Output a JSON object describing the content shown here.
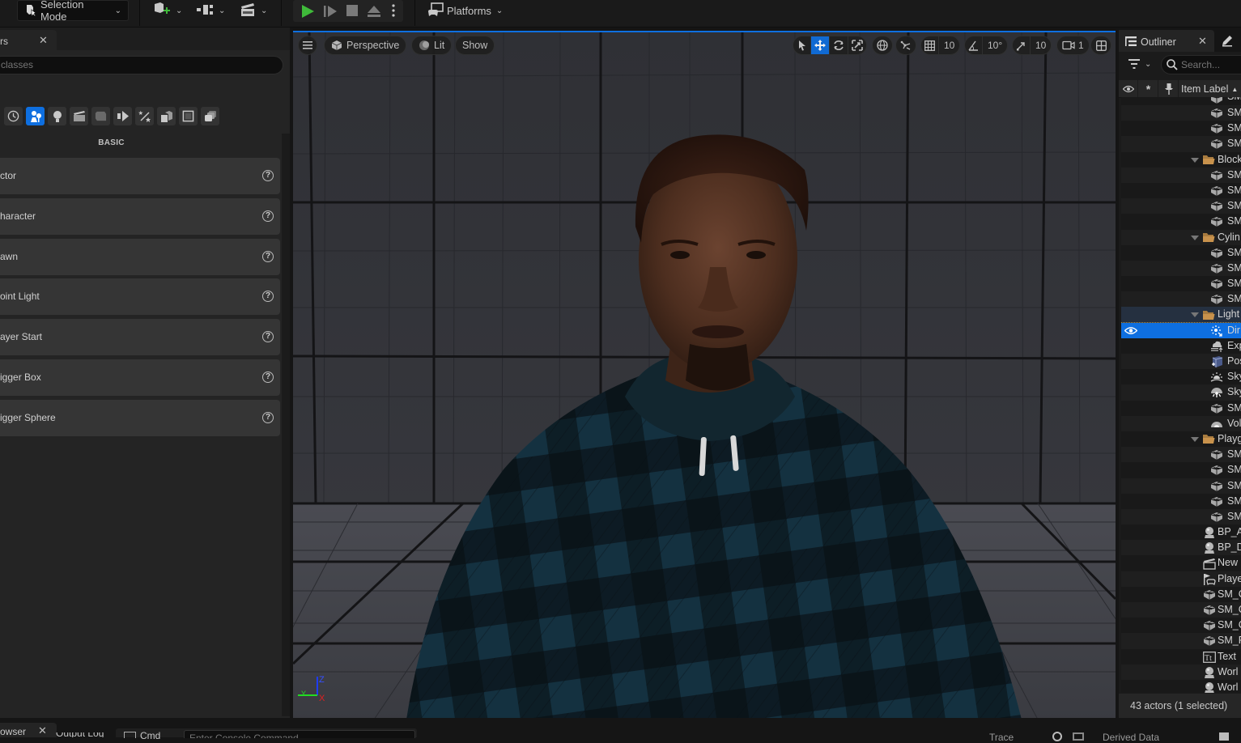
{
  "toolbar": {
    "selection_mode": "Selection Mode",
    "platforms": "Platforms",
    "accent": "#0e6fe0",
    "play_color": "#3fba3a"
  },
  "place_actors": {
    "tab_label": "rs",
    "search_placeholder": "classes",
    "category_label": "BASIC",
    "categories": [
      "recent-icon",
      "basic-icon",
      "lights-icon",
      "cinematic-icon",
      "visual-effects-icon",
      "geometry-icon",
      "volumes-icon",
      "all-classes-icon",
      "shapes-icon",
      "layers-icon"
    ],
    "active_category": 1,
    "items": [
      {
        "label": "ctor"
      },
      {
        "label": "haracter"
      },
      {
        "label": "awn"
      },
      {
        "label": "oint Light"
      },
      {
        "label": "ayer Start"
      },
      {
        "label": "igger Box"
      },
      {
        "label": "igger Sphere"
      }
    ]
  },
  "viewport": {
    "view_mode": "Perspective",
    "lighting": "Lit",
    "show": "Show",
    "grid_snap": "10",
    "rotation_snap": "10°",
    "scale_snap": "10",
    "camera_speed": "1",
    "axis_labels": {
      "x": "X",
      "y": "Y",
      "z": "Z"
    }
  },
  "outliner": {
    "tab_label": "Outliner",
    "search_placeholder": "Search...",
    "column_label": "Item Label",
    "footer": "43 actors (1 selected)",
    "rows": [
      {
        "label": "SM",
        "icon": "static-mesh-icon",
        "indent": 2,
        "partial": true
      },
      {
        "label": "SM",
        "icon": "static-mesh-icon",
        "indent": 2
      },
      {
        "label": "SM",
        "icon": "static-mesh-icon",
        "indent": 2
      },
      {
        "label": "SM",
        "icon": "static-mesh-icon",
        "indent": 2
      },
      {
        "label": "Block",
        "icon": "folder-icon",
        "indent": 1,
        "folder": true
      },
      {
        "label": "SM",
        "icon": "static-mesh-icon",
        "indent": 2
      },
      {
        "label": "SM",
        "icon": "static-mesh-icon",
        "indent": 2
      },
      {
        "label": "SM",
        "icon": "static-mesh-icon",
        "indent": 2
      },
      {
        "label": "SM",
        "icon": "static-mesh-icon",
        "indent": 2
      },
      {
        "label": "Cylin",
        "icon": "folder-icon",
        "indent": 1,
        "folder": true
      },
      {
        "label": "SM",
        "icon": "static-mesh-icon",
        "indent": 2
      },
      {
        "label": "SM",
        "icon": "static-mesh-icon",
        "indent": 2
      },
      {
        "label": "SM",
        "icon": "static-mesh-icon",
        "indent": 2
      },
      {
        "label": "SM",
        "icon": "static-mesh-icon",
        "indent": 2
      },
      {
        "label": "Light",
        "icon": "folder-icon",
        "indent": 1,
        "folder": true,
        "highlight": true
      },
      {
        "label": "Dir",
        "icon": "directional-light-icon",
        "indent": 2,
        "selected": true
      },
      {
        "label": "Exp",
        "icon": "exponential-fog-icon",
        "indent": 2
      },
      {
        "label": "Pos",
        "icon": "post-process-icon",
        "indent": 2
      },
      {
        "label": "Sky",
        "icon": "sky-atmosphere-icon",
        "indent": 2
      },
      {
        "label": "Sky",
        "icon": "sky-light-icon",
        "indent": 2
      },
      {
        "label": "SM",
        "icon": "static-mesh-icon",
        "indent": 2
      },
      {
        "label": "Vol",
        "icon": "volumetric-cloud-icon",
        "indent": 2
      },
      {
        "label": "Playg",
        "icon": "folder-icon",
        "indent": 1,
        "folder": true
      },
      {
        "label": "SM",
        "icon": "static-mesh-icon",
        "indent": 2
      },
      {
        "label": "SM",
        "icon": "static-mesh-icon",
        "indent": 2
      },
      {
        "label": "SM",
        "icon": "static-mesh-icon",
        "indent": 2
      },
      {
        "label": "SM",
        "icon": "static-mesh-icon",
        "indent": 2
      },
      {
        "label": "SM",
        "icon": "static-mesh-icon",
        "indent": 2
      },
      {
        "label": "BP_A",
        "icon": "actor-icon",
        "indent": 0
      },
      {
        "label": "BP_D",
        "icon": "actor-icon",
        "indent": 0
      },
      {
        "label": "New",
        "icon": "level-sequence-icon",
        "indent": 0
      },
      {
        "label": "Playe",
        "icon": "player-start-icon",
        "indent": 0
      },
      {
        "label": "SM_C",
        "icon": "static-mesh-icon",
        "indent": 0
      },
      {
        "label": "SM_C",
        "icon": "static-mesh-icon",
        "indent": 0
      },
      {
        "label": "SM_C",
        "icon": "static-mesh-icon",
        "indent": 0
      },
      {
        "label": "SM_F",
        "icon": "static-mesh-icon",
        "indent": 0
      },
      {
        "label": "Text",
        "icon": "text-render-icon",
        "indent": 0
      },
      {
        "label": "Worl",
        "icon": "actor-icon",
        "indent": 0
      },
      {
        "label": "Worl",
        "icon": "actor-icon",
        "indent": 0
      }
    ]
  },
  "bottom": {
    "content_browser_tab": "owser",
    "output_log_tab": "Output Log",
    "cmd_label": "Cmd",
    "console_placeholder": "Enter Console Command",
    "trace_label": "Trace",
    "derived_data_label": "Derived Data"
  }
}
